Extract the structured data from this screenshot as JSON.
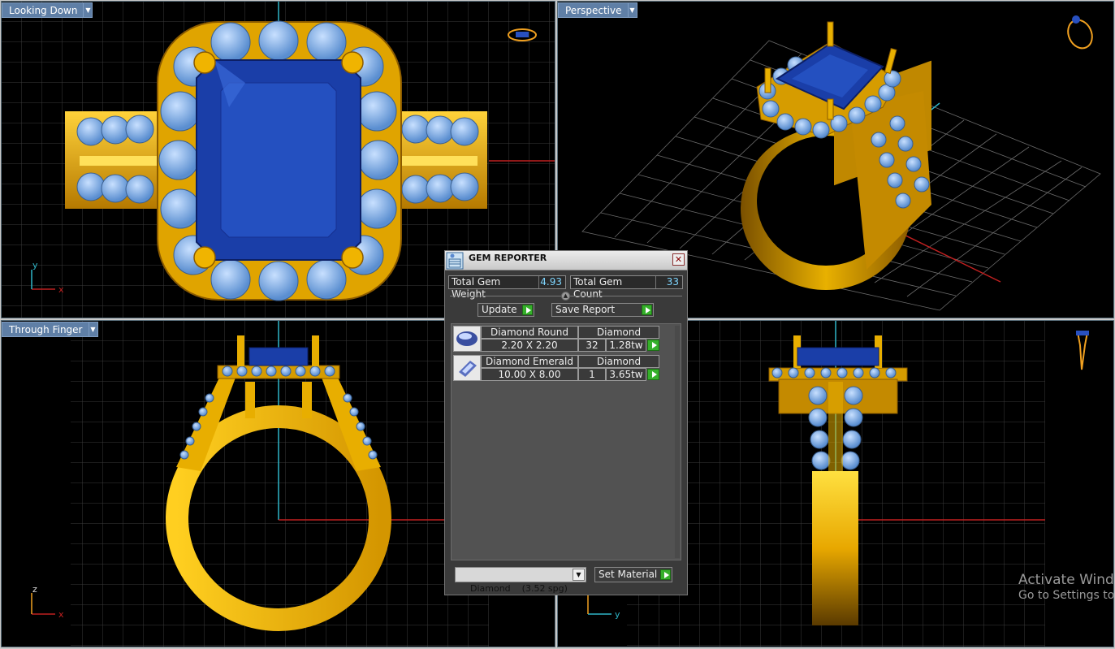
{
  "viewports": {
    "top_left": {
      "label": "Looking Down"
    },
    "top_right": {
      "label": "Perspective"
    },
    "bottom_left": {
      "label": "Through Finger"
    },
    "bottom_right": {
      "label": ""
    }
  },
  "axes": {
    "top_left": {
      "v": "y",
      "h": "x"
    },
    "bottom_left": {
      "v": "z",
      "h": "x"
    },
    "bottom_right": {
      "h": "y"
    }
  },
  "gem_reporter": {
    "title": "GEM REPORTER",
    "total_weight_label": "Total Gem Weight",
    "total_weight": "4.93",
    "total_count_label": "Total Gem Count",
    "total_count": "33",
    "update_label": "Update",
    "save_report_label": "Save Report",
    "gems": [
      {
        "shape": "Diamond Round",
        "material": "Diamond",
        "size": "2.20 X 2.20",
        "count": "32",
        "weight": "1.28tw"
      },
      {
        "shape": "Diamond Emerald",
        "material": "Diamond",
        "size": "10.00 X 8.00",
        "count": "1",
        "weight": "3.65tw"
      }
    ],
    "material_select": "Diamond    (3.52 spg)",
    "set_material_label": "Set Material"
  },
  "watermark": {
    "line1": "Activate Wind",
    "line2": "Go to Settings to"
  },
  "colors": {
    "gold": "#e8a900",
    "sapphire": "#1e3fa8",
    "diamond": "#7eaee0",
    "grid": "#3c3c3c",
    "label_bg": "#5f7fa6"
  }
}
